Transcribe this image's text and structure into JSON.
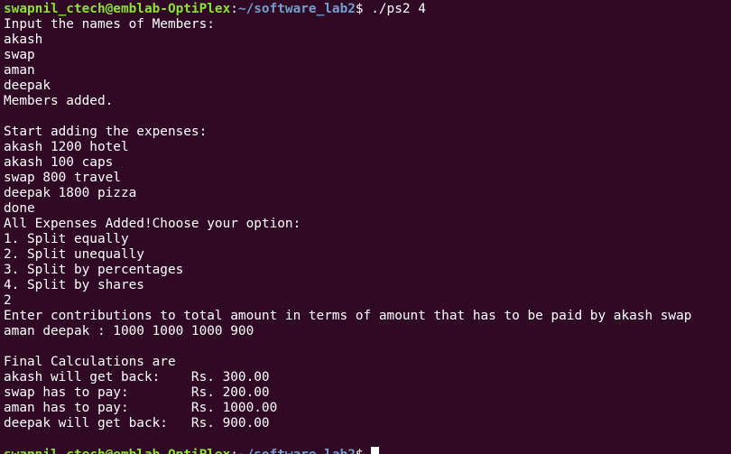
{
  "theme": {
    "background": "#300a24",
    "foreground": "#ffffff",
    "prompt_user_color": "#8ae234",
    "prompt_path_color": "#729fcf"
  },
  "prompt": {
    "user_host": "swapnil_ctech@emblab-OptiPlex",
    "separator": ":",
    "path": "~/software_lab2",
    "symbol": "$ "
  },
  "command": "./ps2 4",
  "output": [
    "Input the names of Members:",
    "akash",
    "swap",
    "aman",
    "deepak",
    "Members added.",
    "",
    "Start adding the expenses:",
    "akash 1200 hotel",
    "akash 100 caps",
    "swap 800 travel",
    "deepak 1800 pizza",
    "done",
    "All Expenses Added!Choose your option:",
    "1. Split equally",
    "2. Split unequally",
    "3. Split by percentages",
    "4. Split by shares",
    "2",
    "Enter contributions to total amount in terms of amount that has to be paid by akash swap",
    "aman deepak : 1000 1000 1000 900",
    "",
    "Final Calculations are",
    "akash will get back:    Rs. 300.00",
    "swap has to pay:        Rs. 200.00",
    "aman has to pay:        Rs. 1000.00",
    "deepak will get back:   Rs. 900.00",
    ""
  ]
}
